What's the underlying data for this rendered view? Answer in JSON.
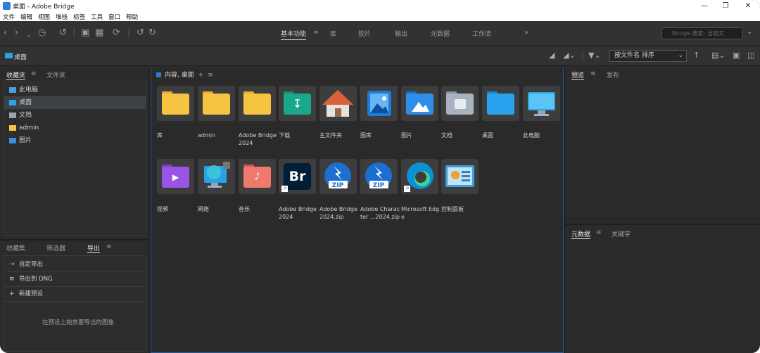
{
  "window": {
    "title": "桌面 - Adobe Bridge"
  },
  "menu": [
    "文件",
    "编辑",
    "视图",
    "堆栈",
    "标签",
    "工具",
    "窗口",
    "帮助"
  ],
  "workspaces": [
    {
      "label": "基本功能",
      "active": true
    },
    {
      "label": "库",
      "active": false
    },
    {
      "label": "胶片",
      "active": false
    },
    {
      "label": "输出",
      "active": false
    },
    {
      "label": "元数据",
      "active": false
    },
    {
      "label": "工作流",
      "active": false
    }
  ],
  "search": {
    "placeholder": "Bridge 搜索: 当前文"
  },
  "path": {
    "label": "桌面"
  },
  "sort": {
    "label": "按文件名 排序"
  },
  "left_top_tabs": [
    "收藏夹",
    "文件夹"
  ],
  "favorites": [
    {
      "label": "此电脑",
      "icon": "monitor-icon"
    },
    {
      "label": "桌面",
      "icon": "desktop-icon",
      "selected": true
    },
    {
      "label": "文档",
      "icon": "document-icon"
    },
    {
      "label": "admin",
      "icon": "folder-icon"
    },
    {
      "label": "图片",
      "icon": "picture-icon"
    }
  ],
  "left_bottom_tabs": [
    "收藏集",
    "筛选器",
    "导出"
  ],
  "export_items": [
    {
      "label": "自定导出",
      "icon": "export-icon"
    },
    {
      "label": "导出到 DNG",
      "icon": "list-icon"
    },
    {
      "label": "新建预设",
      "icon": "plus-icon"
    }
  ],
  "export_drop_msg": "在预设上拖放要导出的图像",
  "content": {
    "tab": "内容, 桌面"
  },
  "items": [
    {
      "label": "库",
      "kind": "folder-yellow"
    },
    {
      "label": "admin",
      "kind": "folder-yellow"
    },
    {
      "label": "Adobe Bridge 2024",
      "kind": "folder-yellow"
    },
    {
      "label": "下载",
      "kind": "downloads"
    },
    {
      "label": "主文件夹",
      "kind": "home"
    },
    {
      "label": "图库",
      "kind": "gallery"
    },
    {
      "label": "图片",
      "kind": "pictures"
    },
    {
      "label": "文档",
      "kind": "documents"
    },
    {
      "label": "桌面",
      "kind": "desktop"
    },
    {
      "label": "此电脑",
      "kind": "computer"
    },
    {
      "label": "视频",
      "kind": "videos"
    },
    {
      "label": "网络",
      "kind": "network"
    },
    {
      "label": "音乐",
      "kind": "music"
    },
    {
      "label": "Adobe Bridge 2024",
      "kind": "br"
    },
    {
      "label": "Adobe Bridge 2024.zip",
      "kind": "zip"
    },
    {
      "label": "Adobe Character ...2024.zip",
      "kind": "zip"
    },
    {
      "label": "Microsoft Edge",
      "kind": "edge"
    },
    {
      "label": "控制面板",
      "kind": "control"
    }
  ],
  "right_top_tabs": [
    "预览",
    "发布"
  ],
  "right_bottom_tabs": [
    "元数据",
    "关键字"
  ],
  "colors": {
    "accent": "#2d7dd2",
    "folder": "#f5c542",
    "panel": "#2b2b2b"
  }
}
